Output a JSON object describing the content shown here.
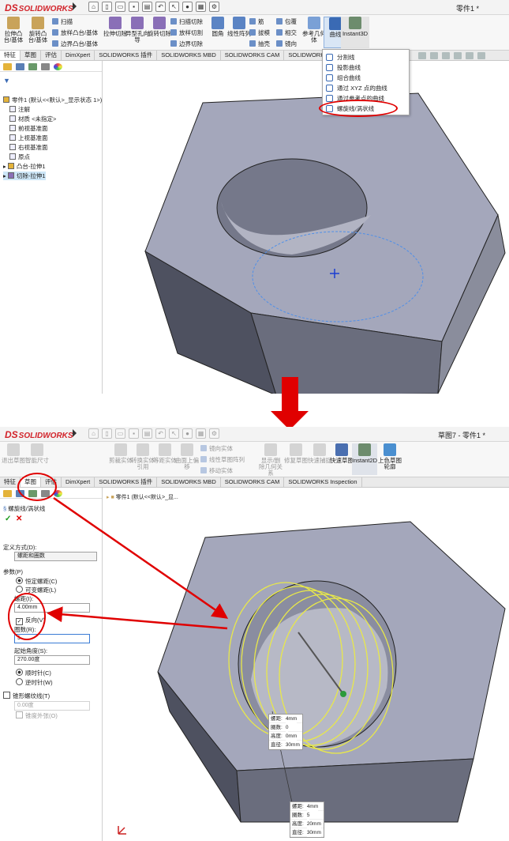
{
  "app": {
    "brand": "SOLIDWORKS",
    "brand_prefix": "DS"
  },
  "top": {
    "doc_title": "零件1 *",
    "ribbon": {
      "big": [
        "拉伸凸台/基体",
        "旋转凸台/基体",
        "拉伸切除",
        "异型孔向导",
        "旋转切除",
        "圆角",
        "线性阵列",
        "参考几何体",
        "曲线",
        "Instant3D"
      ],
      "small_col1": [
        "扫描",
        "放样凸台/基体",
        "边界凸台/基体"
      ],
      "small_col2": [
        "扫描切除",
        "放样切割",
        "边界切除"
      ],
      "small_col3": [
        "筋",
        "拔模",
        "抽壳"
      ],
      "small_col4": [
        "包覆",
        "相交",
        "镜向"
      ]
    },
    "tabs": [
      "特征",
      "草图",
      "评估",
      "DimXpert",
      "SOLIDWORKS 插件",
      "SOLIDWORKS MBD",
      "SOLIDWORKS CAM",
      "SOLIDWORKS Inspection"
    ],
    "active_tab": 0,
    "tree": {
      "root": "零件1 (默认<<默认>_显示状态 1>)",
      "items": [
        "注解",
        "材质 <未指定>",
        "前视基准面",
        "上视基准面",
        "右视基准面",
        "原点",
        "凸台-拉伸1",
        "切除-拉伸1"
      ]
    },
    "curve_menu": [
      "分割线",
      "投影曲线",
      "组合曲线",
      "通过 XYZ 点的曲线",
      "通过参考点的曲线",
      "螺旋线/涡状线"
    ],
    "highlighted_item": "螺旋线/涡状线"
  },
  "bottom": {
    "doc_title": "草图7 - 零件1 *",
    "ribbon": {
      "big": [
        "退出草图",
        "智能尺寸",
        "剪裁实体",
        "转换实体引用",
        "等距实体",
        "曲面上偏移",
        "显示/删除几何关系",
        "修复草图",
        "快速捕捉",
        "快速草图",
        "Instant2D",
        "上色草图轮廓"
      ],
      "small": [
        "镜向实体",
        "线性草图阵列",
        "移动实体"
      ]
    },
    "tabs": [
      "特征",
      "草图",
      "评估",
      "DimXpert",
      "SOLIDWORKS 插件",
      "SOLIDWORKS MBD",
      "SOLIDWORKS CAM",
      "SOLIDWORKS Inspection"
    ],
    "active_tab": 1,
    "breadcrumb": "零件1 (默认<<默认>_显...",
    "property_manager": {
      "title": "螺旋线/涡状线",
      "define_by_label": "定义方式(D):",
      "define_by_value": "螺距和圈数",
      "params_label": "参数(P)",
      "radio_constant": "恒定螺距(C)",
      "radio_variable": "可变螺距(L)",
      "pitch_label": "螺距(I):",
      "pitch_value": "4.00mm",
      "reverse_label": "反向(V)",
      "revolutions_label": "圈数(R):",
      "revolutions_value": "5",
      "start_angle_label": "起始角度(S):",
      "start_angle_value": "270.00度",
      "radio_cw": "顺时针(C)",
      "radio_ccw": "逆时针(W)",
      "taper_label": "锥形螺纹线(T)",
      "taper_value": "0.00度",
      "taper_out": "锥度外张(O)"
    },
    "callout1": [
      [
        "螺距:",
        "4mm"
      ],
      [
        "圈数:",
        "0"
      ],
      [
        "高度:",
        "0mm"
      ],
      [
        "直径:",
        "30mm"
      ]
    ],
    "callout2": [
      [
        "螺距:",
        "4mm"
      ],
      [
        "圈数:",
        "5"
      ],
      [
        "高度:",
        "20mm"
      ],
      [
        "直径:",
        "30mm"
      ]
    ]
  },
  "colors": {
    "annotation_red": "#e00000",
    "helix_yellow": "#e8e84a",
    "nut_face": "#a4a7bb",
    "nut_side": "#5f6272"
  },
  "icons": [
    "new-file-icon",
    "open-folder-icon",
    "save-icon",
    "print-icon",
    "undo-icon",
    "select-arrow-icon",
    "rebuild-icon",
    "options-gear-icon",
    "filter-icon",
    "helix-icon",
    "confirm-check-icon",
    "cancel-x-icon"
  ]
}
